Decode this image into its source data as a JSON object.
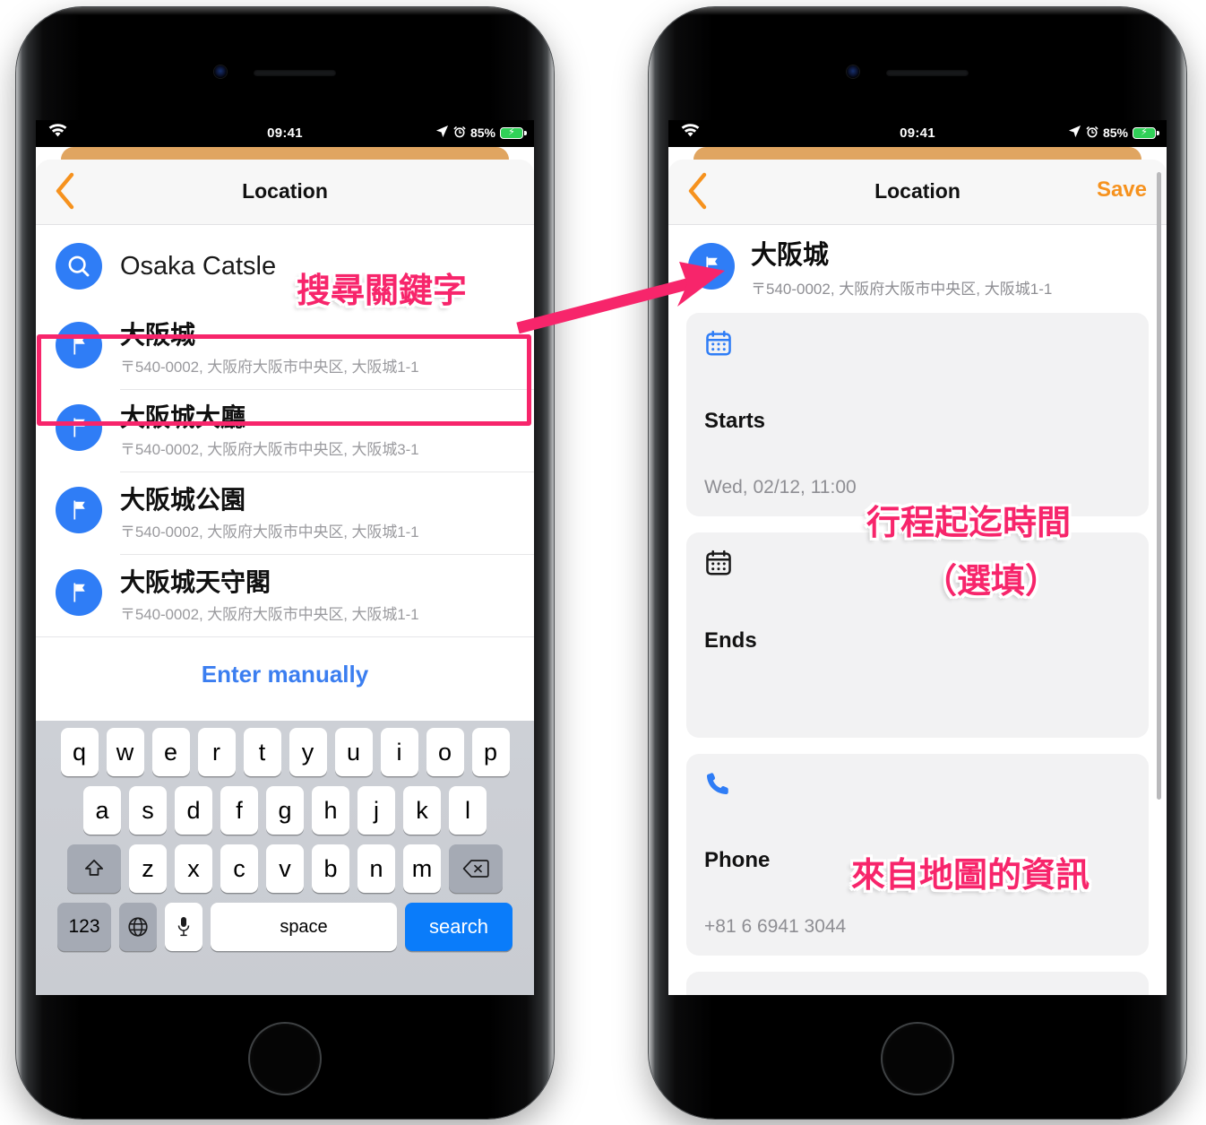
{
  "status_bar": {
    "time": "09:41",
    "battery_percent": "85%",
    "wifi_icon": "wifi-icon",
    "location_icon": "location-arrow-icon",
    "alarm_icon": "alarm-clock-icon",
    "battery_icon": "battery-charging-icon"
  },
  "colors": {
    "accent_blue": "#2f7df6",
    "nav_orange": "#f6921e",
    "annotation_pink": "#f7256b",
    "link_blue": "#3b7ef0",
    "card_bg": "#f2f2f3",
    "battery_green": "#30d158"
  },
  "left_phone": {
    "nav": {
      "title": "Location",
      "back_icon": "chevron-left-icon"
    },
    "search": {
      "value": "Osaka Catsle",
      "icon": "search-icon"
    },
    "results": [
      {
        "title": "大阪城",
        "address": "〒540-0002, 大阪府大阪市中央区, 大阪城1-1",
        "icon": "flag-pin-icon",
        "selected": true
      },
      {
        "title": "大阪城大廳",
        "address": "〒540-0002, 大阪府大阪市中央区, 大阪城3-1",
        "icon": "flag-pin-icon",
        "selected": false
      },
      {
        "title": "大阪城公園",
        "address": "〒540-0002, 大阪府大阪市中央区, 大阪城1-1",
        "icon": "flag-pin-icon",
        "selected": false
      },
      {
        "title": "大阪城天守閣",
        "address": "〒540-0002, 大阪府大阪市中央区, 大阪城1-1",
        "icon": "flag-pin-icon",
        "selected": false
      }
    ],
    "manual_entry_label": "Enter manually",
    "keyboard": {
      "row1": [
        "q",
        "w",
        "e",
        "r",
        "t",
        "y",
        "u",
        "i",
        "o",
        "p"
      ],
      "row2": [
        "a",
        "s",
        "d",
        "f",
        "g",
        "h",
        "j",
        "k",
        "l"
      ],
      "row3": [
        "z",
        "x",
        "c",
        "v",
        "b",
        "n",
        "m"
      ],
      "shift_icon": "shift-arrow-icon",
      "backspace_icon": "backspace-icon",
      "numbers_label": "123",
      "globe_icon": "globe-icon",
      "mic_icon": "microphone-icon",
      "space_label": "space",
      "return_label": "search"
    }
  },
  "right_phone": {
    "nav": {
      "title": "Location",
      "back_icon": "chevron-left-icon",
      "save_label": "Save"
    },
    "place": {
      "title": "大阪城",
      "address": "〒540-0002, 大阪府大阪市中央区, 大阪城1-1",
      "icon": "flag-pin-icon"
    },
    "cards": [
      {
        "icon": "calendar-icon",
        "icon_color": "blue",
        "label": "Starts",
        "value": "Wed, 02/12, 11:00"
      },
      {
        "icon": "calendar-icon",
        "icon_color": "black",
        "label": "Ends",
        "value": ""
      },
      {
        "icon": "phone-icon",
        "icon_color": "blue",
        "label": "Phone",
        "value": "+81 6 6941 3044"
      }
    ]
  },
  "annotations": [
    {
      "id": "search-keyword",
      "text": "搜尋關鍵字"
    },
    {
      "id": "trip-time-range",
      "text": "行程起迄時間"
    },
    {
      "id": "optional",
      "text": "（選填）"
    },
    {
      "id": "map-info",
      "text": "來自地圖的資訊"
    }
  ]
}
